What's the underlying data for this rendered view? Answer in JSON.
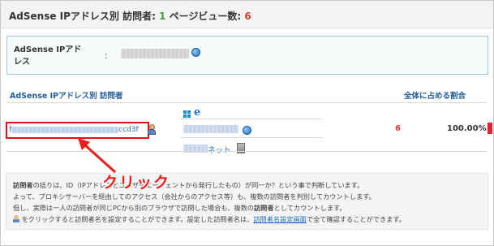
{
  "header": {
    "title_prefix": "AdSense IPアドレス別 訪問者: ",
    "visitors": "1",
    "pageviews_label": "ページビュー数: ",
    "pageviews": "6"
  },
  "info": {
    "label": "AdSense IPアドレス",
    "colon": ":"
  },
  "table": {
    "col_visitor": "AdSense IPアドレス別 訪問者",
    "col_share": "全体に占める割合",
    "row": {
      "visitor_prefix": "f",
      "visitor_suffix": "ccd3f",
      "network_suffix": "ネット",
      "count": "6",
      "percent": "100.00%"
    }
  },
  "notes": {
    "line1_term": "訪問者",
    "line1_rest": "の括りは、ID（IPアドレスとユーザーエージェントから発行したもの）が同一か？という事で判断しています。",
    "line2": "よって、プロキシサーバーを経由してのアクセス（会社からのアクセス等）も、複数の訪問者を判別してカウントします。",
    "line3_a": "但し、実際は一人の訪問者が同じPCから別のブラウザで訪問した場合も、複数の",
    "line3_term": "訪問者",
    "line3_b": "としてカウントします。",
    "line4_a": "をクリックすると訪問者名を設定することができます。設定した訪問者名は、",
    "line4_link": "訪問者名設定画面",
    "line4_b": "で全て確認することができます。"
  },
  "annotation": {
    "label": "クリック",
    "color": "#ee1b1b"
  },
  "colors": {
    "visitors": "#3a9d2f",
    "pageviews": "#e03a2f",
    "accent_blue": "#1f5c9a",
    "highlight_red": "#e8101a"
  },
  "icons": [
    "globe-icon",
    "user-icon",
    "windows-icon",
    "edge-icon",
    "building-icon"
  ]
}
